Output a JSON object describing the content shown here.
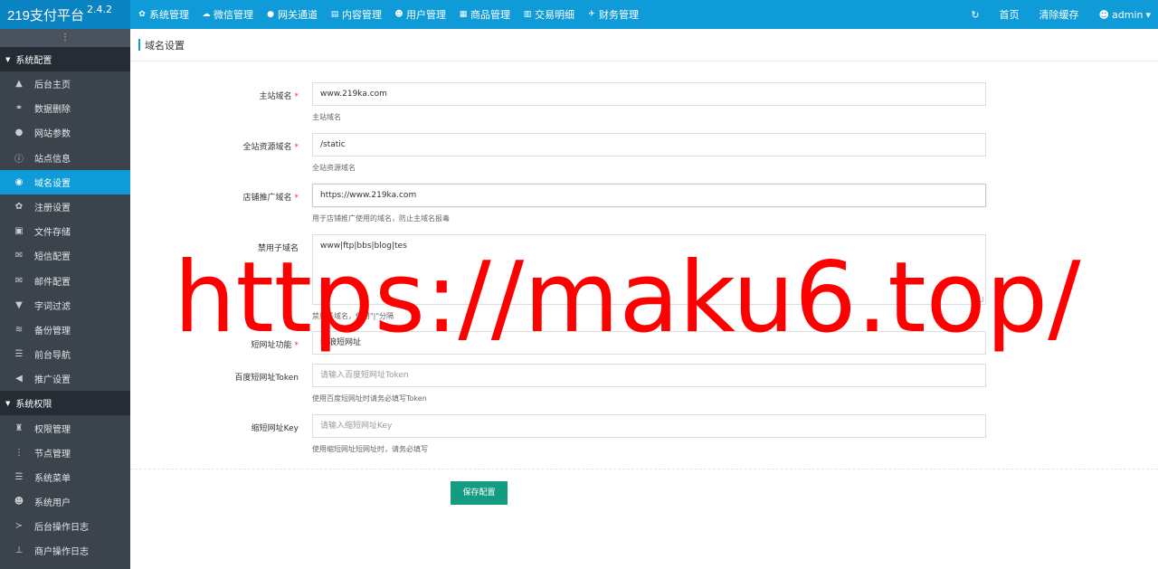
{
  "brand": {
    "name": "219支付平台",
    "version": "2.4.2"
  },
  "nav": [
    {
      "icon": "gear-icon",
      "glyph": "✿",
      "label": "系统管理"
    },
    {
      "icon": "wechat-icon",
      "glyph": "☁",
      "label": "微信管理"
    },
    {
      "icon": "gateway-icon",
      "glyph": "●",
      "label": "网关通道"
    },
    {
      "icon": "content-icon",
      "glyph": "▤",
      "label": "内容管理"
    },
    {
      "icon": "users-icon",
      "glyph": "☻",
      "label": "用户管理"
    },
    {
      "icon": "shop-icon",
      "glyph": "▦",
      "label": "商品管理"
    },
    {
      "icon": "bar-chart-icon",
      "glyph": "▥",
      "label": "交易明细"
    },
    {
      "icon": "finance-icon",
      "glyph": "✈",
      "label": "财务管理"
    }
  ],
  "topright": {
    "refresh_glyph": "↻",
    "home": "首页",
    "clear_cache": "清除缓存",
    "user": "admin",
    "user_caret": "▾"
  },
  "sidebar": {
    "toggle": "⋮",
    "groups": [
      {
        "title": "系统配置",
        "items": [
          {
            "glyph": "▲",
            "label": "后台主页"
          },
          {
            "glyph": "⚭",
            "label": "数据删除"
          },
          {
            "glyph": "●",
            "label": "网站参数"
          },
          {
            "glyph": "ⓘ",
            "label": "站点信息"
          },
          {
            "glyph": "◉",
            "label": "域名设置",
            "active": true
          },
          {
            "glyph": "✿",
            "label": "注册设置"
          },
          {
            "glyph": "▣",
            "label": "文件存储"
          },
          {
            "glyph": "✉",
            "label": "短信配置"
          },
          {
            "glyph": "✉",
            "label": "邮件配置"
          },
          {
            "glyph": "▼",
            "label": "字词过滤"
          },
          {
            "glyph": "≋",
            "label": "备份管理"
          },
          {
            "glyph": "☰",
            "label": "前台导航"
          },
          {
            "glyph": "◀",
            "label": "推广设置"
          }
        ]
      },
      {
        "title": "系统权限",
        "items": [
          {
            "glyph": "♜",
            "label": "权限管理"
          },
          {
            "glyph": "⋮",
            "label": "节点管理"
          },
          {
            "glyph": "☰",
            "label": "系统菜单"
          },
          {
            "glyph": "☻",
            "label": "系统用户"
          },
          {
            "glyph": "≻",
            "label": "后台操作日志"
          },
          {
            "glyph": "⊥",
            "label": "商户操作日志"
          }
        ]
      }
    ]
  },
  "page": {
    "title": "域名设置"
  },
  "form": {
    "main_domain": {
      "label": "主站域名",
      "value": "www.219ka.com",
      "help": "主站域名"
    },
    "static_domain": {
      "label": "全站资源域名",
      "value": "/static",
      "help": "全站资源域名"
    },
    "shop_domain": {
      "label": "店铺推广域名",
      "value": "https://www.219ka.com",
      "help": "用于店铺推广使用的域名，防止主域名报毒"
    },
    "banned_sub": {
      "label": "禁用子域名",
      "value": "www|ftp|bbs|blog|tes",
      "help": "禁用子域名，使用\"|\"分隔"
    },
    "short_url": {
      "label": "短网址功能",
      "value": "新浪短网址"
    },
    "baidu_token": {
      "label": "百度短网址Token",
      "placeholder": "请输入百度短网址Token",
      "help": "使用百度短网址时请务必填写Token"
    },
    "suo_key": {
      "label": "缩短网址Key",
      "placeholder": "请输入缩短网址Key",
      "help": "使用缩短网址短网址时，请务必填写"
    },
    "save": "保存配置"
  },
  "watermark": "https://maku6.top/"
}
